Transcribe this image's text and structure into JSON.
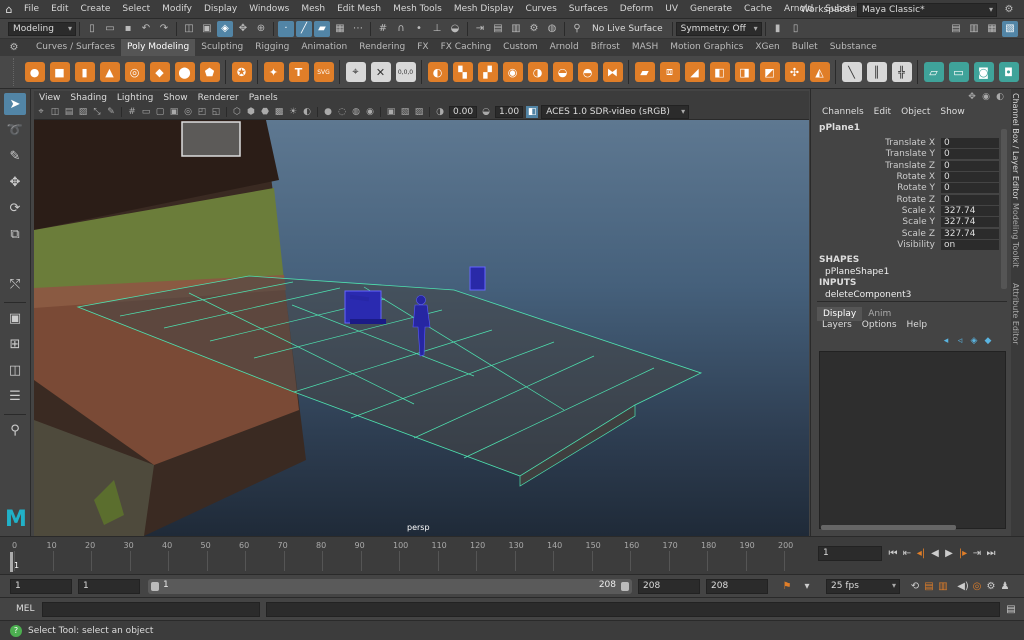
{
  "menubar": {
    "items": [
      "File",
      "Edit",
      "Create",
      "Select",
      "Modify",
      "Display",
      "Windows",
      "Mesh",
      "Edit Mesh",
      "Mesh Tools",
      "Mesh Display",
      "Curves",
      "Surfaces",
      "Deform",
      "UV",
      "Generate",
      "Cache",
      "Arnold",
      "Substance",
      "Help"
    ],
    "workspace_label": "Workspace:",
    "workspace_value": "Maya Classic*"
  },
  "statusline": {
    "mode": "Modeling",
    "live_surface": "No Live Surface",
    "symmetry": "Symmetry: Off"
  },
  "shelf_tabs": [
    "Curves / Surfaces",
    "Poly Modeling",
    "Sculpting",
    "Rigging",
    "Animation",
    "Rendering",
    "FX",
    "FX Caching",
    "Custom",
    "Arnold",
    "Bifrost",
    "MASH",
    "Motion Graphics",
    "XGen",
    "Bullet",
    "Substance"
  ],
  "shelf_active": "Poly Modeling",
  "shelf_text_icons": {
    "type": "T",
    "svg": "SVG",
    "uv": "0,0,0"
  },
  "viewport": {
    "menu": [
      "View",
      "Shading",
      "Lighting",
      "Show",
      "Renderer",
      "Panels"
    ],
    "near": "0.00",
    "far": "1.00",
    "color_space": "ACES 1.0 SDR-video (sRGB)",
    "camera_label": "persp"
  },
  "channel_box": {
    "menu": [
      "Channels",
      "Edit",
      "Object",
      "Show"
    ],
    "object": "pPlane1",
    "attributes": [
      {
        "name": "Translate X",
        "value": "0"
      },
      {
        "name": "Translate Y",
        "value": "0"
      },
      {
        "name": "Translate Z",
        "value": "0"
      },
      {
        "name": "Rotate X",
        "value": "0"
      },
      {
        "name": "Rotate Y",
        "value": "0"
      },
      {
        "name": "Rotate Z",
        "value": "0"
      },
      {
        "name": "Scale X",
        "value": "327.74"
      },
      {
        "name": "Scale Y",
        "value": "327.74"
      },
      {
        "name": "Scale Z",
        "value": "327.74"
      },
      {
        "name": "Visibility",
        "value": "on"
      }
    ],
    "shapes_heading": "SHAPES",
    "shape_name": "pPlaneShape1",
    "inputs_heading": "INPUTS",
    "input_name": "deleteComponent3",
    "layer_tabs": [
      "Display",
      "Anim"
    ],
    "layer_menu": [
      "Layers",
      "Options",
      "Help"
    ]
  },
  "side_tabs": [
    "Channel Box / Layer Editor",
    "Modeling Toolkit",
    "Attribute Editor"
  ],
  "timeline": {
    "ticks": [
      "0",
      "10",
      "20",
      "30",
      "40",
      "50",
      "60",
      "70",
      "80",
      "90",
      "100",
      "110",
      "120",
      "130",
      "140",
      "150",
      "160",
      "170",
      "180",
      "190",
      "200"
    ],
    "current_frame_marker": "1",
    "current_frame_field": "1"
  },
  "range": {
    "start": "1",
    "playback_start": "1",
    "slider_start": "1",
    "slider_end": "208",
    "playback_end": "208",
    "end": "208",
    "fps": "25 fps"
  },
  "mel": {
    "label": "MEL"
  },
  "help": {
    "text": "Select Tool: select an object"
  }
}
